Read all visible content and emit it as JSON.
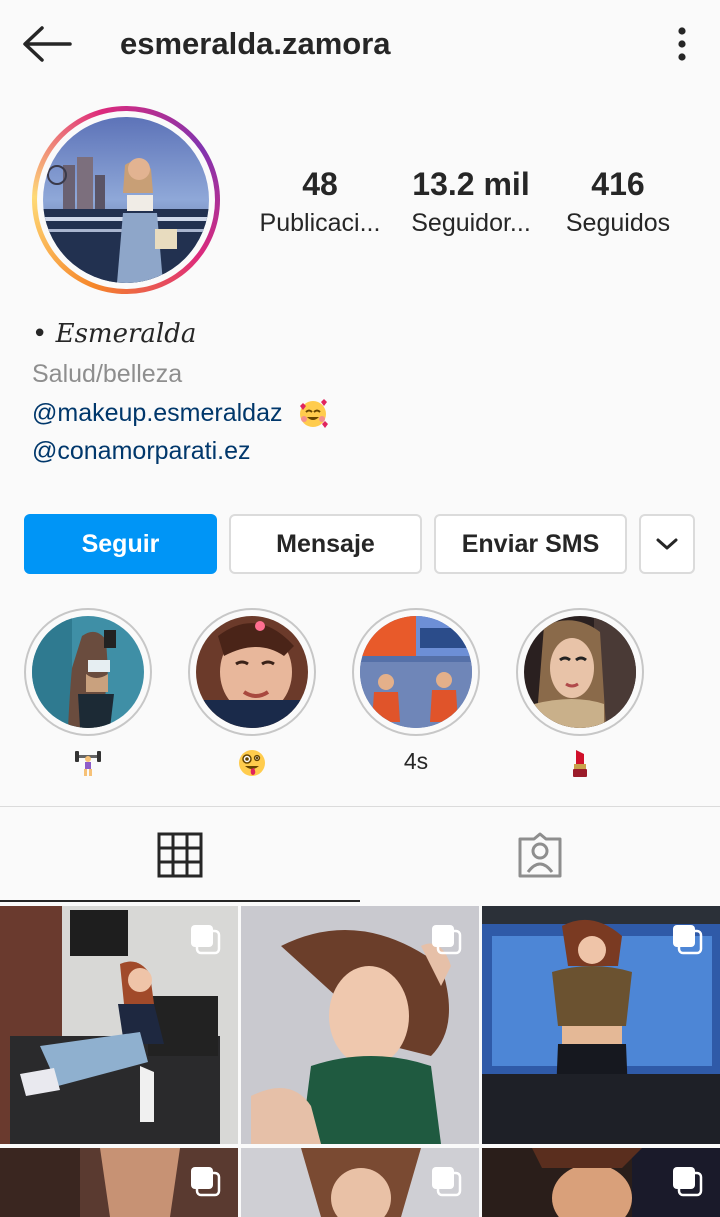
{
  "header": {
    "username": "esmeralda.zamora",
    "back_icon": "arrow-left-icon",
    "menu_icon": "more-vertical-icon"
  },
  "profile": {
    "stats": [
      {
        "value": "48",
        "label": "Publicaci..."
      },
      {
        "value": "13.2 mil",
        "label": "Seguidor..."
      },
      {
        "value": "416",
        "label": "Seguidos"
      }
    ],
    "name": "• Esmeralda",
    "category": "Salud/belleza",
    "links": [
      "@makeup.esmeraldaz",
      "@conamorparati.ez"
    ],
    "link_emoji": "smiling-face-with-hearts-icon"
  },
  "actions": {
    "follow": "Seguir",
    "message": "Mensaje",
    "sms": "Enviar SMS",
    "more_icon": "chevron-down-icon"
  },
  "highlights": [
    {
      "caption": "",
      "icon": "weightlifter-icon"
    },
    {
      "caption": "",
      "icon": "zany-face-icon"
    },
    {
      "caption": "4s",
      "icon": ""
    },
    {
      "caption": "",
      "icon": "lipstick-icon"
    }
  ],
  "tabs": [
    {
      "icon": "grid-icon",
      "active": true
    },
    {
      "icon": "tagged-user-icon",
      "active": false
    }
  ],
  "colors": {
    "primary": "#0095f6",
    "link": "#00376b",
    "muted": "#8e8e8e",
    "border": "#dbdbdb"
  }
}
